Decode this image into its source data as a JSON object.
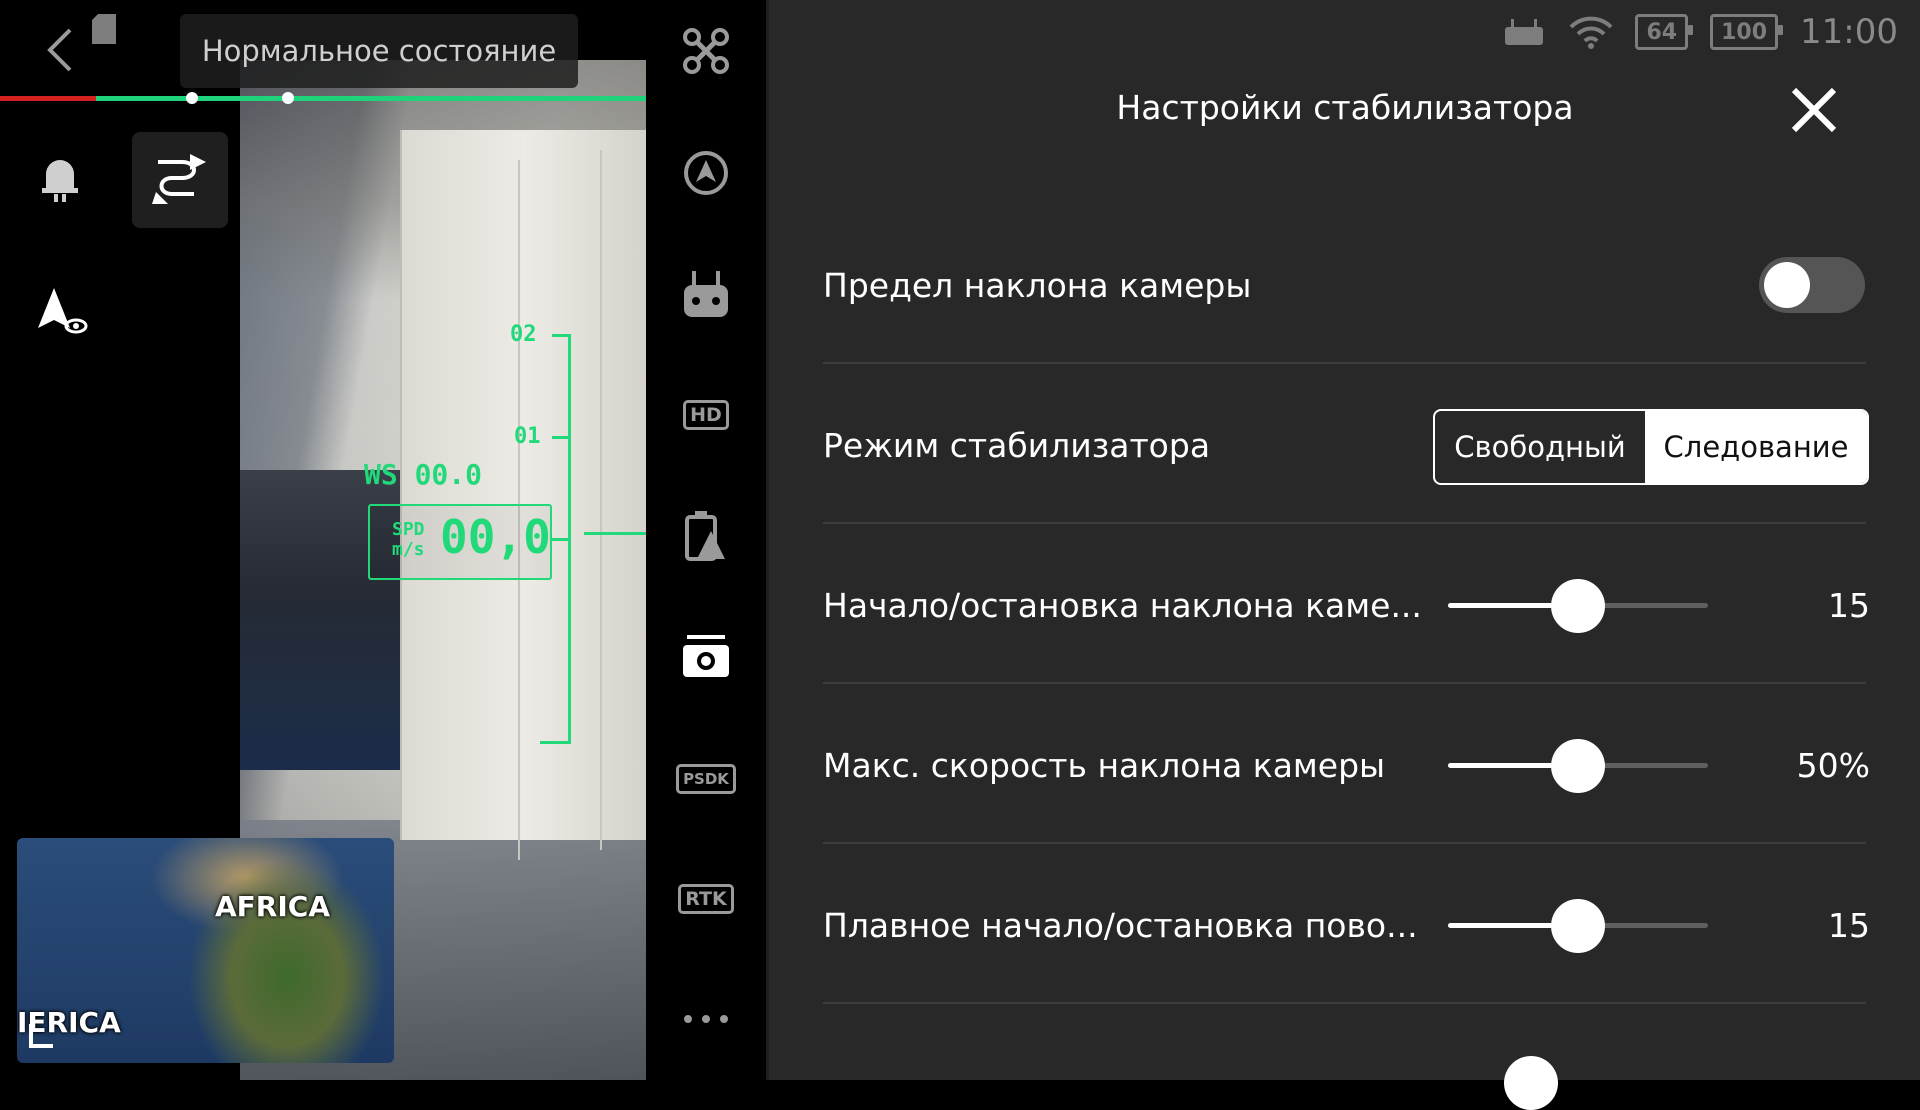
{
  "header": {
    "status_text": "Нормальное состояние"
  },
  "hud": {
    "wind_speed": "WS 00.0",
    "speed_label_line1": "SPD",
    "speed_label_line2": "m/s",
    "speed_value": "00,0",
    "altitude_scale": [
      "02",
      "01"
    ]
  },
  "mini_map": {
    "label_africa": "AFRICA",
    "label_america": "IERICA"
  },
  "toolbar": {
    "items": [
      "aircraft-icon",
      "gimbal-icon",
      "remote-controller-icon",
      "HD",
      "battery-icon",
      "camera-icon",
      "PSDK",
      "RTK",
      "more-icon"
    ],
    "hd_label": "HD",
    "psdk_label": "PSDK",
    "rtk_label": "RTK"
  },
  "status_bar": {
    "battery_left": "64",
    "battery_right": "100",
    "clock": "11:00"
  },
  "panel": {
    "title": "Настройки стабилизатора",
    "rows": {
      "tilt_limit": {
        "label": "Предел наклона камеры",
        "enabled": false
      },
      "gimbal_mode": {
        "label": "Режим стабилизатора",
        "options": [
          "Свободный",
          "Следование"
        ],
        "selected": "Следование"
      },
      "tilt_smooth": {
        "label": "Начало/остановка наклона каме...",
        "value_text": "15",
        "level": 0.5
      },
      "tilt_max_speed": {
        "label": "Макс. скорость наклона камеры",
        "value_text": "50%",
        "level": 0.5
      },
      "yaw_smooth": {
        "label": "Плавное начало/остановка пово...",
        "value_text": "15",
        "level": 0.5
      }
    }
  },
  "colors": {
    "hud_green": "#22d97a",
    "accent_red": "#d62020",
    "panel_bg": "#2b2b2b"
  }
}
